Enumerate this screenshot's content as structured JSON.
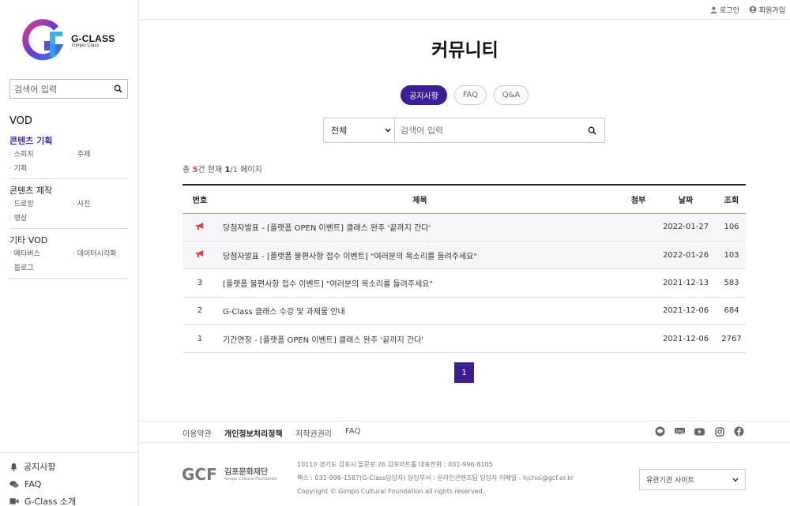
{
  "brand": {
    "logo_name": "G-CLASS",
    "logo_sub": "Gimpo Class"
  },
  "colors": {
    "accent": "#3d1e96",
    "notice_icon": "#e0404a",
    "count_highlight": "#c44a8a"
  },
  "sidebar": {
    "search_placeholder": "검색어 입력",
    "section_title": "VOD",
    "groups": [
      {
        "label": "콘텐츠 기획",
        "active": true,
        "items": [
          "스피치",
          "주제",
          "기획"
        ]
      },
      {
        "label": "콘텐츠 제작",
        "active": false,
        "items": [
          "드로잉",
          "사진",
          "영상"
        ]
      },
      {
        "label": "기타 VOD",
        "active": false,
        "items": [
          "메타버스",
          "데이터시각화",
          "블로그"
        ]
      }
    ],
    "bottom": [
      {
        "label": "공지사항",
        "icon": "bell-icon"
      },
      {
        "label": "FAQ",
        "icon": "chat-icon"
      },
      {
        "label": "G-Class 소개",
        "icon": "video-icon"
      }
    ]
  },
  "topbar": {
    "login": "로그인",
    "signup": "회원가입"
  },
  "page": {
    "title": "커뮤니티",
    "tabs": [
      {
        "label": "공지사항",
        "active": true
      },
      {
        "label": "FAQ",
        "active": false
      },
      {
        "label": "Q&A",
        "active": false
      }
    ],
    "search": {
      "select_value": "전체",
      "placeholder": "검색어 입력"
    },
    "summary": {
      "prefix": "총 ",
      "count": "5",
      "mid": "건 현재 ",
      "current": "1",
      "suffix": "/1 페이지"
    },
    "table": {
      "headers": {
        "no": "번호",
        "title": "제목",
        "attach": "첨부",
        "date": "날짜",
        "views": "조회"
      },
      "rows": [
        {
          "no": "",
          "notice": true,
          "title": "당첨자발표 - [플랫폼 OPEN 이벤트] 클래스 완주 '끝까지 간다'",
          "date": "2022-01-27",
          "views": "106"
        },
        {
          "no": "",
          "notice": true,
          "title": "당첨자발표 - [플랫폼 불편사항 접수 이벤트] \"여러분의 목소리를 들려주세요\"",
          "date": "2022-01-26",
          "views": "103"
        },
        {
          "no": "3",
          "notice": false,
          "title": "[플랫폼 불편사항 접수 이벤트] \"여러분의 목소리를 들려주세요\"",
          "date": "2021-12-13",
          "views": "583"
        },
        {
          "no": "2",
          "notice": false,
          "title": "G-Class 클래스 수강 및 과제물 안내",
          "date": "2021-12-06",
          "views": "684"
        },
        {
          "no": "1",
          "notice": false,
          "title": "기간연장 - [플랫폼 OPEN 이벤트] 클래스 완주 '끝까지 간다'",
          "date": "2021-12-06",
          "views": "2767"
        }
      ]
    },
    "pagination": {
      "current": "1"
    }
  },
  "footer": {
    "links": [
      "이용약관",
      "개인정보처리정책",
      "저작권권리",
      "FAQ"
    ],
    "social_icons": [
      "kakao-icon",
      "blog-icon",
      "youtube-icon",
      "instagram-icon",
      "facebook-icon"
    ],
    "org_name": "김포문화재단",
    "org_name_en": "Gimpo Cultural Foundation",
    "org_logo_letters": "GCF",
    "address": "10110 경기도 김포시 돌문로 26 김포아트홀   대표전화 : 031-996-8105",
    "fax": "팩스 : 031-996-1587(G-Class담당자)    담당부서 : 온라인콘텐츠팀    담당자 이메일 : hjchoi@gcf.or.kr",
    "copyright": "Copyright © Gimpo Cultural Foundation all rights reserved.",
    "related_select": "유관기관 사이트"
  }
}
